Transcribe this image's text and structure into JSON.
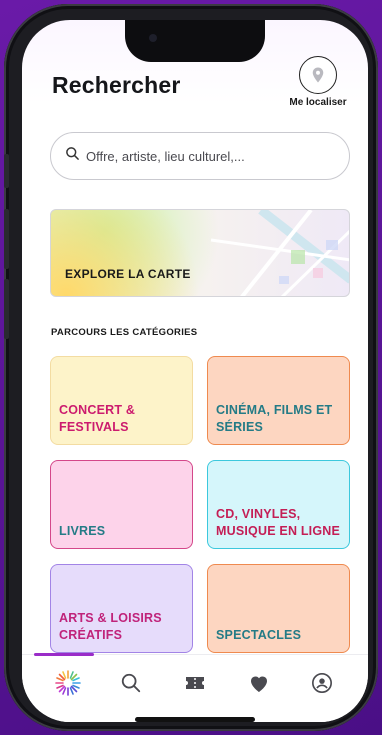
{
  "header": {
    "title": "Rechercher",
    "locate_label": "Me localiser",
    "locate_icon": "location-pin-icon"
  },
  "search": {
    "placeholder": "Offre, artiste, lieu culturel,...",
    "value": "",
    "icon": "search-icon"
  },
  "map_card": {
    "label": "EXPLORE LA CARTE"
  },
  "categories_section": {
    "title": "PARCOURS LES CATÉGORIES",
    "items": [
      {
        "label": "CONCERT & FESTIVALS",
        "color": "#cc1b6e",
        "background": "#fdf3c9"
      },
      {
        "label": "CINÉMA, FILMS ET SÉRIES",
        "color": "#247b86",
        "background": "#fdd6c1"
      },
      {
        "label": "LIVRES",
        "color": "#247b86",
        "background": "#fdd3ea"
      },
      {
        "label": "CD, VINYLES, MUSIQUE EN LIGNE",
        "color": "#c41e55",
        "background": "#d5f6fb"
      },
      {
        "label": "ARTS & LOISIRS CRÉATIFS",
        "color": "#c0237a",
        "background": "#e6dcfb"
      },
      {
        "label": "SPECTACLES",
        "color": "#247b86",
        "background": "#fdd6c1"
      }
    ]
  },
  "tabbar": {
    "items": [
      {
        "icon": "discover-logo-icon",
        "active": true
      },
      {
        "icon": "search-icon",
        "active": false
      },
      {
        "icon": "ticket-icon",
        "active": false
      },
      {
        "icon": "heart-icon",
        "active": false
      },
      {
        "icon": "profile-icon",
        "active": false
      }
    ],
    "active_color": "#9a2cc8"
  }
}
